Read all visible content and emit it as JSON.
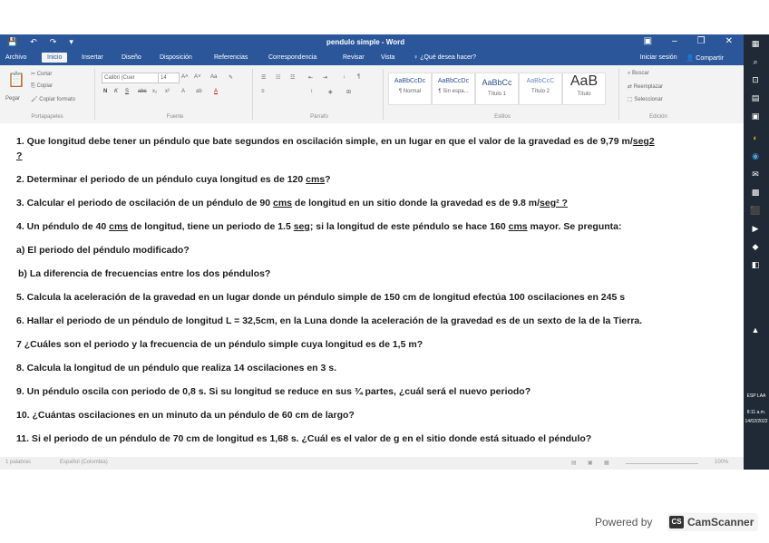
{
  "app": {
    "title": "pendulo simple - Word",
    "qat": [
      "💾",
      "↶",
      "↷",
      "▾"
    ],
    "window_controls": [
      "▣",
      "–",
      "❐",
      "✕"
    ]
  },
  "tabs": {
    "items": [
      "Archivo",
      "Inicio",
      "Insertar",
      "Diseño",
      "Disposición",
      "Referencias",
      "Correspondencia",
      "Revisar",
      "Vista"
    ],
    "tell_me": "¿Qué desea hacer?",
    "signin": "Iniciar sesión",
    "share": "Compartir"
  },
  "ribbon": {
    "clipboard": {
      "paste": "Pegar",
      "cut": "Cortar",
      "copy": "Copiar",
      "format_painter": "Copiar formato",
      "label": "Portapapeles"
    },
    "font": {
      "name": "Calibri (Cuer",
      "size": "14",
      "grow": "A˄",
      "shrink": "A˅",
      "case": "Aa",
      "clear": "✎",
      "bold": "N",
      "italic": "K",
      "underline": "S",
      "strike": "abc",
      "subscript": "x₂",
      "superscript": "x²",
      "effects": "A",
      "highlight": "ab",
      "color": "A",
      "label": "Fuente"
    },
    "paragraph": {
      "bullets": "☰",
      "numbering": "☷",
      "multilevel": "☲",
      "decrease": "⇤",
      "increase": "⇥",
      "sort": "↓",
      "marks": "¶",
      "align": "≡",
      "spacing": "↕",
      "shading": "◈",
      "borders": "⊞",
      "label": "Párrafo"
    },
    "styles": {
      "items": [
        {
          "sample": "AaBbCcDc",
          "name": "¶ Normal"
        },
        {
          "sample": "AaBbCcDc",
          "name": "¶ Sin espa..."
        },
        {
          "sample": "AaBbCc",
          "name": "Título 1"
        },
        {
          "sample": "AaBbCcC",
          "name": "Título 2"
        },
        {
          "sample": "AaB",
          "name": "Título"
        }
      ],
      "label": "Estilos"
    },
    "editing": {
      "find": "Buscar",
      "replace": "Reemplazar",
      "select": "Seleccionar",
      "label": "Edición"
    }
  },
  "document": {
    "q1": {
      "text": "1. Que longitud debe tener un péndulo que bate segundos en oscilación simple, en un lugar en que el valor de la gravedad es de 9,79 m/",
      "u": "seg2",
      "cont": "?"
    },
    "q2": {
      "pre": "2. Determinar el periodo de un péndulo cuya longitud es de 120 ",
      "u": "cms",
      "post": "?"
    },
    "q3": {
      "pre": "3. Calcular el periodo de oscilación de un péndulo de 90 ",
      "u1": "cms",
      "mid": " de longitud en un sitio donde la gravedad es de 9.8 m/",
      "u2": "seg² ?"
    },
    "q4": {
      "p1": "4. Un péndulo de 40 ",
      "u1": "cms",
      "p2": " de longitud, tiene un periodo de 1.5 ",
      "u2": "seg",
      "p3": "; si la longitud de este péndulo se hace 160 ",
      "u3": "cms",
      "p4": " mayor. Se pregunta:"
    },
    "q4a": "a) El periodo del péndulo modificado?",
    "q4b": "b) La diferencia de frecuencias entre los dos péndulos?",
    "q5": "5. Calcula la aceleración de la gravedad en un lugar donde un péndulo simple de 150 cm de longitud efectúa 100 oscilaciones en 245 s",
    "q6": "6. Hallar el periodo de un péndulo de longitud L = 32,5cm, en la Luna donde la aceleración de la gravedad es de un sexto de la de la Tierra.",
    "q7": "7 ¿Cuáles son el periodo y la frecuencia de un péndulo simple cuya longitud es de 1,5 m?",
    "q8": "8. Calcula la longitud de un péndulo que realiza 14 oscilaciones en 3 s.",
    "q9": "9. Un péndulo oscila con periodo de 0,8 s. Si su longitud se reduce en sus ¾ partes, ¿cuál será el nuevo periodo?",
    "q10": "10. ¿Cuántas oscilaciones en un minuto da un péndulo de 60 cm de largo?",
    "q11": "11. Si el periodo de un péndulo de 70 cm de longitud es 1,68 s. ¿Cuál es el valor de g en el sitio donde está situado el péndulo?"
  },
  "statusbar": {
    "words": "1 palabras",
    "language": "Español (Colombia)",
    "zoom": "100%"
  },
  "taskbar": {
    "icons": [
      "▦",
      "⌕",
      "⊡",
      "▤",
      "▣",
      "◐",
      "◉",
      "✉",
      "▩",
      "⬛",
      "▶",
      "◆",
      "◧",
      "▲"
    ],
    "lang": "ESP LAA",
    "time": "8:11 a.m.",
    "date": "14/02/2022"
  },
  "watermark": {
    "powered_by": "Powered by",
    "logo": "CS",
    "brand": "CamScanner"
  },
  "colors": {
    "word_blue": "#2b579a",
    "ribbon_bg": "#f3f3f3",
    "taskbar": "#1f2a36"
  }
}
